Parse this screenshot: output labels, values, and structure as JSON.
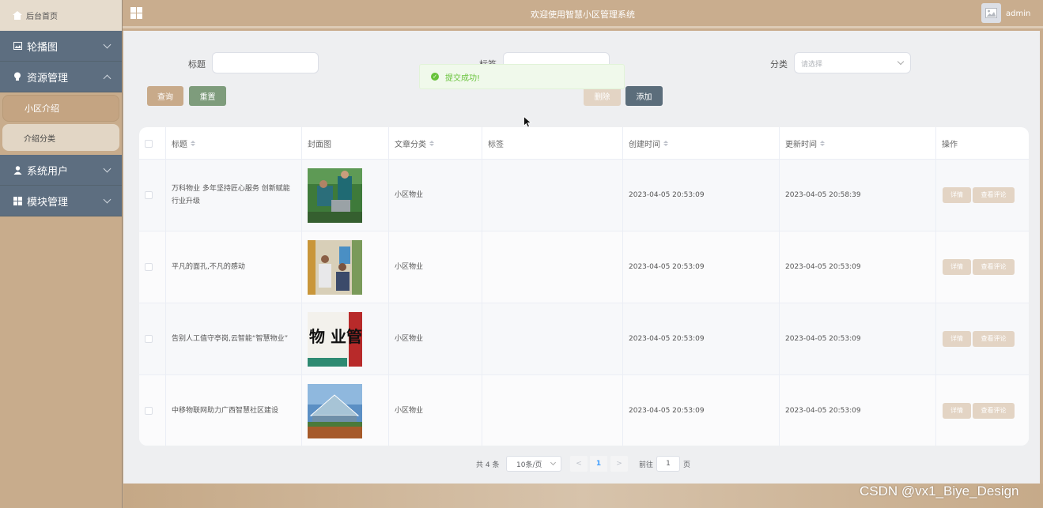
{
  "sidebar": {
    "home_label": "后台首页",
    "menus": [
      {
        "label": "轮播图",
        "icon": "picture-icon",
        "expanded": false
      },
      {
        "label": "资源管理",
        "icon": "bulb-icon",
        "expanded": true
      },
      {
        "label": "系统用户",
        "icon": "user-icon",
        "expanded": false
      },
      {
        "label": "模块管理",
        "icon": "grid-icon",
        "expanded": false
      }
    ],
    "submenu": [
      {
        "label": "小区介绍",
        "active": true
      },
      {
        "label": "介绍分类",
        "active": false
      }
    ]
  },
  "header": {
    "title": "欢迎使用智慧小区管理系统",
    "username": "admin"
  },
  "search": {
    "title_label": "标题",
    "tag_label": "标签",
    "category_label": "分类",
    "category_placeholder": "请选择"
  },
  "buttons": {
    "query": "查询",
    "reset": "重置",
    "delete": "删除",
    "add": "添加"
  },
  "toast": {
    "message": "提交成功!"
  },
  "table": {
    "columns": [
      "标题",
      "封面图",
      "文章分类",
      "标签",
      "创建时间",
      "更新时间",
      "操作"
    ],
    "rows": [
      {
        "title": "万科物业 多年坚持匠心服务 创新赋能行业升级",
        "category": "小区物业",
        "tag": "",
        "created": "2023-04-05 20:53:09",
        "updated": "2023-04-05 20:58:39"
      },
      {
        "title": "平凡的面孔,不凡的感动",
        "category": "小区物业",
        "tag": "",
        "created": "2023-04-05 20:53:09",
        "updated": "2023-04-05 20:53:09"
      },
      {
        "title": "告别人工值守亭岗,云智能“智慧物业”",
        "category": "小区物业",
        "tag": "",
        "created": "2023-04-05 20:53:09",
        "updated": "2023-04-05 20:53:09"
      },
      {
        "title": "中移物联网助力广西智慧社区建设",
        "category": "小区物业",
        "tag": "",
        "created": "2023-04-05 20:53:09",
        "updated": "2023-04-05 20:53:09"
      }
    ],
    "op_detail": "详情",
    "op_comments": "查看评论",
    "cover3_text": "物 业管"
  },
  "pagination": {
    "total": "共 4 条",
    "page_size": "10条/页",
    "current": "1",
    "goto": "前往",
    "goto_value": "1",
    "page_unit": "页",
    "prev": "<",
    "next": ">"
  },
  "watermark": "CSDN @vx1_Biye_Design",
  "colors": {
    "sidebar_bg": "#c8ac8c",
    "menu_bg": "#5d6e80",
    "accent_green": "#67c23a",
    "reset_btn": "#7e9c7c",
    "add_btn": "#5b6d7b"
  }
}
